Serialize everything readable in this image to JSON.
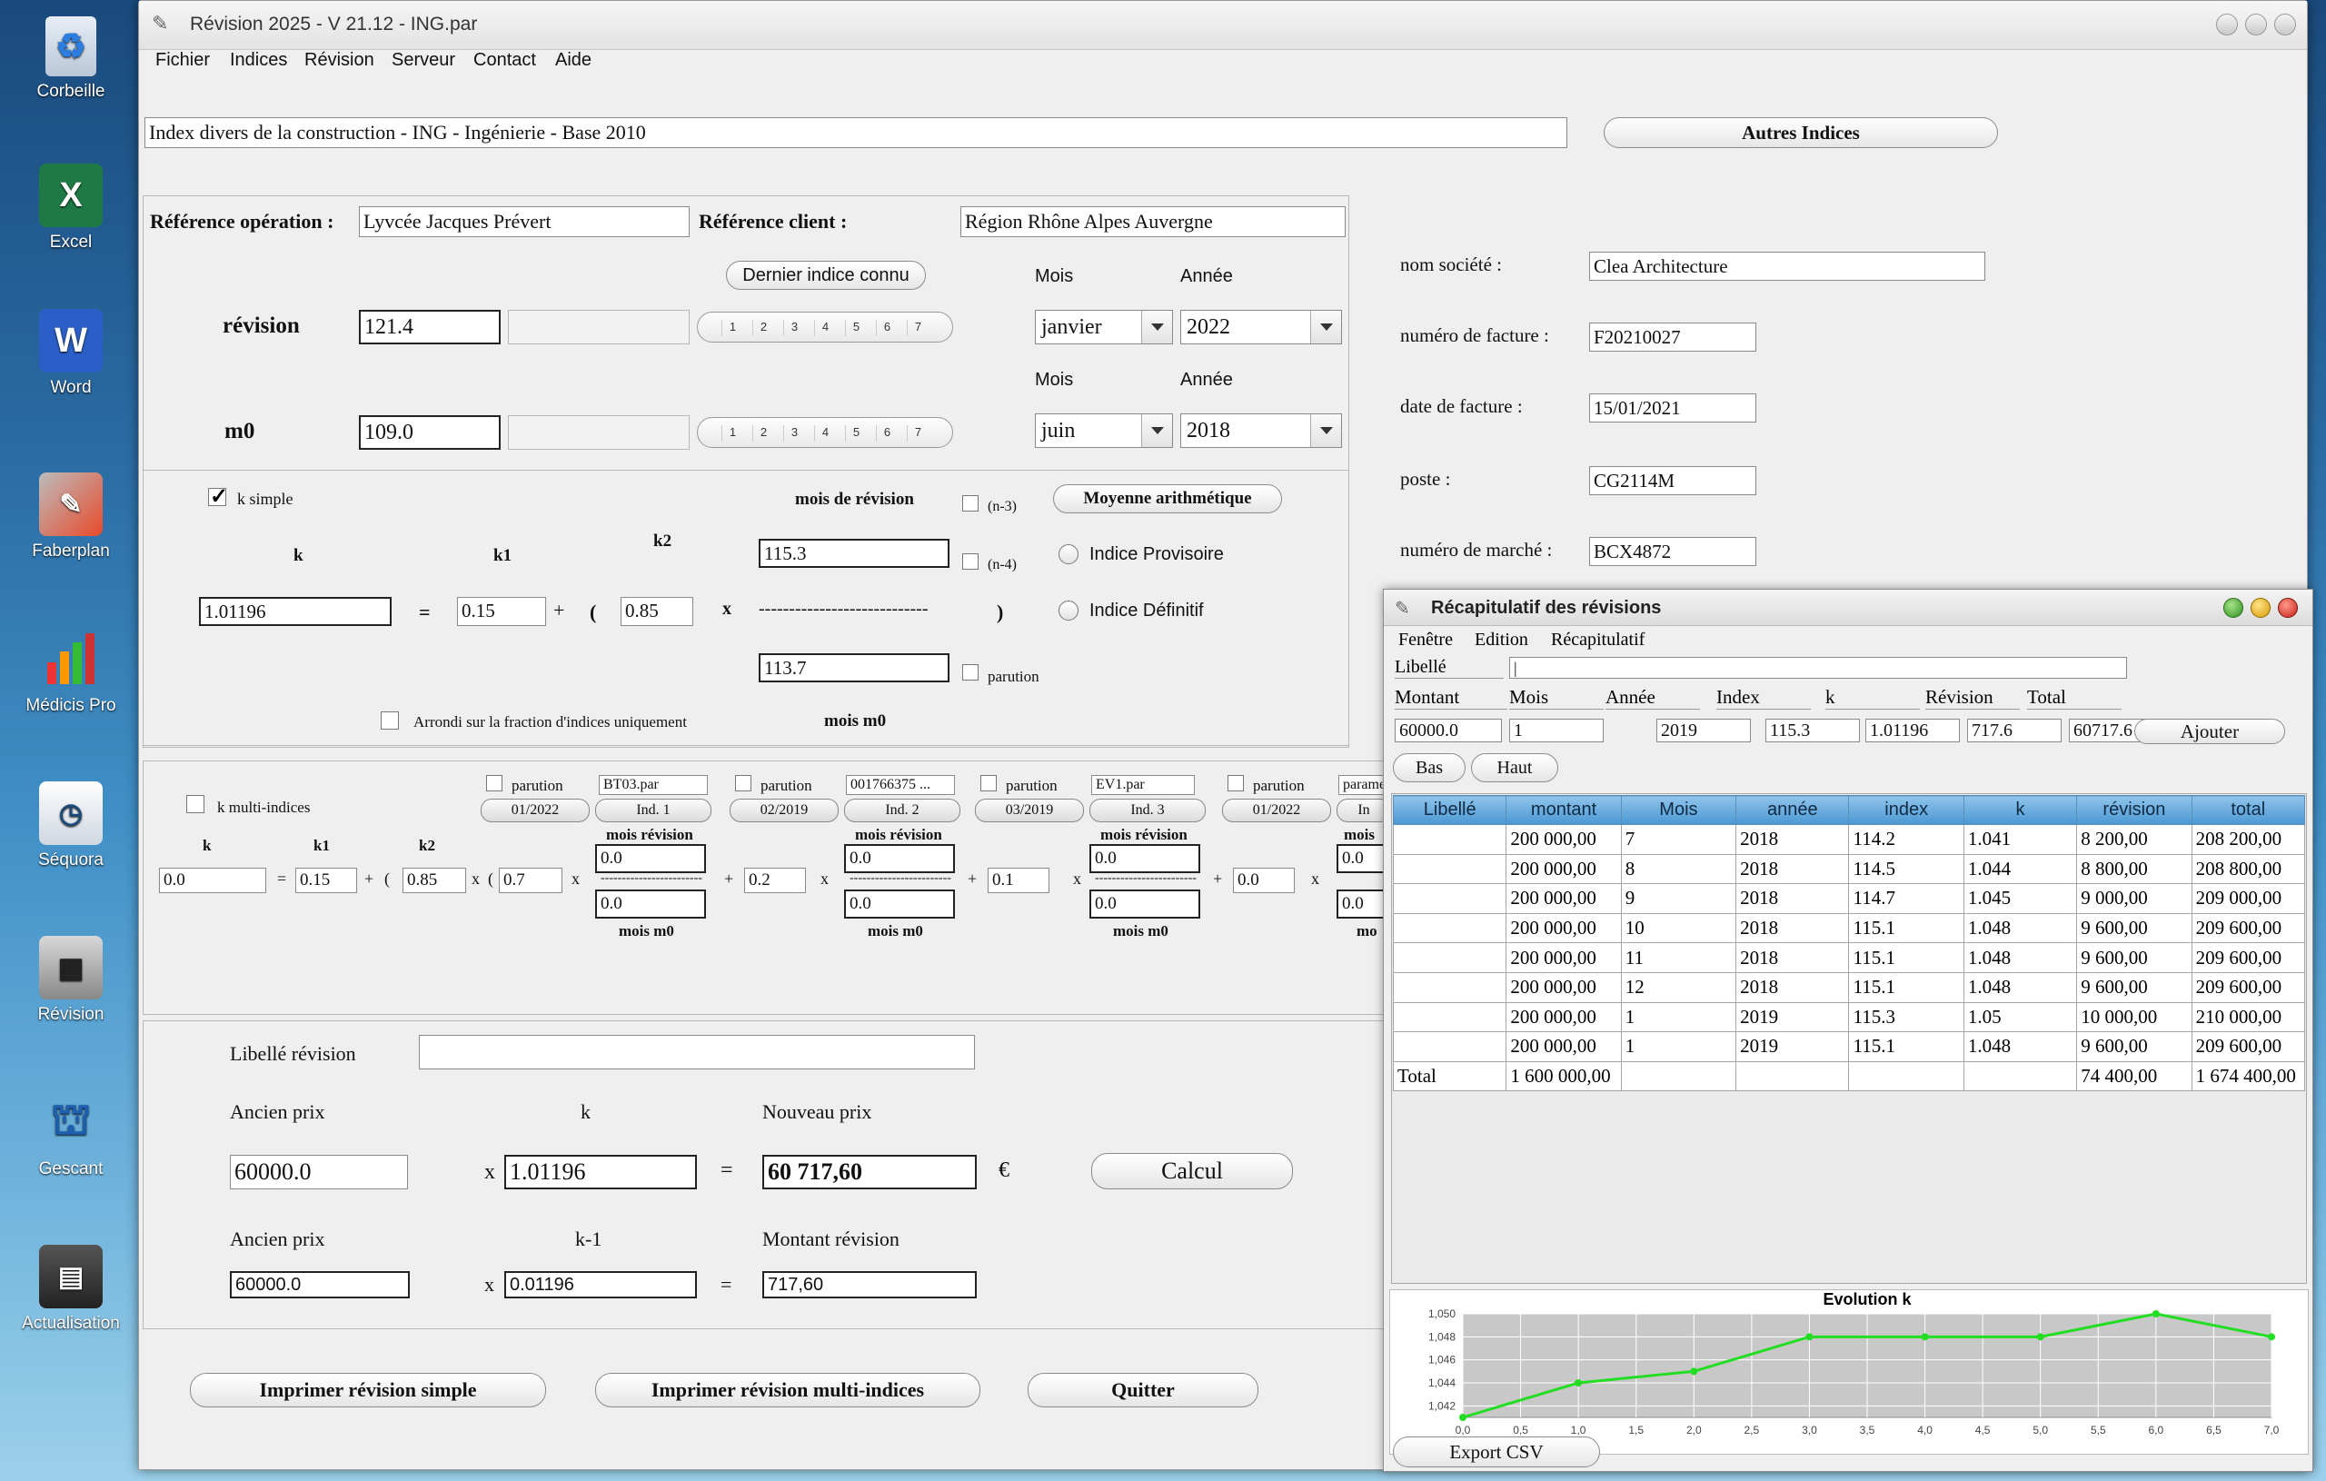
{
  "desktop": {
    "icons": [
      {
        "label": "Corbeille",
        "name": "recycle-bin-icon"
      },
      {
        "label": "Excel",
        "name": "excel-icon"
      },
      {
        "label": "Word",
        "name": "word-icon"
      },
      {
        "label": "Faberplan",
        "name": "faberplan-icon"
      },
      {
        "label": "Médicis Pro",
        "name": "medicis-pro-icon"
      },
      {
        "label": "Séquora",
        "name": "sequora-icon"
      },
      {
        "label": "Révision",
        "name": "revision-app-icon"
      },
      {
        "label": "Gescant",
        "name": "gescant-icon"
      },
      {
        "label": "Actualisation",
        "name": "actualisation-icon"
      }
    ]
  },
  "window": {
    "title": "Révision 2025 - V 21.12 - ING.par"
  },
  "menu": [
    "Fichier",
    "Indices",
    "Révision",
    "Serveur",
    "Contact",
    "Aide"
  ],
  "index_title": "Index divers de la construction - ING - Ingénierie - Base 2010",
  "autres_indices": "Autres Indices",
  "ref_op_label": "Référence opération :",
  "ref_op_value": "Lyvcée Jacques Prévert",
  "ref_client_label": "Référence client :",
  "ref_client_value": "Région Rhône Alpes Auvergne",
  "dernier_indice": "Dernier indice connu",
  "mois_label": "Mois",
  "annee_label": "Année",
  "revision_label": "révision",
  "revision_value": "121.4",
  "revision_mois": "janvier",
  "revision_annee": "2022",
  "m0_label": "m0",
  "m0_value": "109.0",
  "m0_mois": "juin",
  "m0_annee": "2018",
  "slider_ticks": [
    "1",
    "2",
    "3",
    "4",
    "5",
    "6",
    "7"
  ],
  "company": {
    "nom_label": "nom société :",
    "nom_value": "Clea Architecture",
    "facture_label": "numéro de facture :",
    "facture_value": "F20210027",
    "date_label": "date de facture :",
    "date_value": "15/01/2021",
    "poste_label": "poste :",
    "poste_value": "CG2114M",
    "marche_label": "numéro de marché :",
    "marche_value": "BCX4872"
  },
  "ksimple": {
    "label": "k simple",
    "mois_revision": "mois de révision",
    "n3": "(n-3)",
    "n4": "(n-4)",
    "moyenne": "Moyenne arithmétique",
    "provisoire": "Indice Provisoire",
    "definitif": "Indice Définitif",
    "k_label": "k",
    "k1_label": "k1",
    "k2_label": "k2",
    "k_value": "1.01196",
    "k1_value": "0.15",
    "k2_value": "0.85",
    "num_value": "115.3",
    "den_value": "113.7",
    "equals": "=",
    "plus": "+",
    "open": "(",
    "times": "x",
    "close": ")",
    "dashes": "----------------------------",
    "parution": "parution",
    "arrondi": "Arrondi sur la fraction d'indices uniquement",
    "mois_m0": "mois m0"
  },
  "kmulti": {
    "label": "k multi-indices",
    "k_label": "k",
    "k1_label": "k1",
    "k2_label": "k2",
    "k_value": "0.0",
    "k1_value": "0.15",
    "k2_value": "0.85",
    "first_coef": "0.7",
    "parution": "parution",
    "mois_revision": "mois révision",
    "mois_m0": "mois m0",
    "dashes": "------------------------",
    "groups": [
      {
        "file": "BT03.par",
        "date": "01/2022",
        "ind": "Ind. 1",
        "num": "0.0",
        "den": "0.0",
        "coef": "0.2"
      },
      {
        "file": "001766375  ...",
        "date": "02/2019",
        "ind": "Ind. 2",
        "num": "0.0",
        "den": "0.0",
        "coef": "0.1"
      },
      {
        "file": "EV1.par",
        "date": "03/2019",
        "ind": "Ind. 3",
        "num": "0.0",
        "den": "0.0",
        "coef": "0.0"
      },
      {
        "file": "parame",
        "date": "01/2022",
        "ind": "In",
        "num": "0.0",
        "den": "0.0",
        "coef": ""
      }
    ],
    "trunc_mois": "mois",
    "trunc_mo": "mo"
  },
  "calc": {
    "libelle_label": "Libellé révision",
    "libelle_value": "",
    "ancien_label": "Ancien prix",
    "k_label": "k",
    "nouveau_label": "Nouveau prix",
    "ancien_value": "60000.0",
    "k_value": "1.01196",
    "nouveau_value": "60 717,60",
    "euro": "€",
    "calcul": "Calcul",
    "ancien2_label": "Ancien prix",
    "km1_label": "k-1",
    "montant_label": "Montant révision",
    "ancien2_value": "60000.0",
    "km1_value": "0.01196",
    "montant_value": "717,60",
    "x": "x",
    "eq": "="
  },
  "buttons": {
    "print_simple": "Imprimer révision simple",
    "print_multi": "Imprimer révision multi-indices",
    "quit": "Quitter"
  },
  "recap": {
    "title": "Récapitulatif des révisions",
    "menu": [
      "Fenêtre",
      "Edition",
      "Récapitulatif"
    ],
    "libelle_label": "Libellé",
    "libelle_value": "|",
    "headers": [
      "Montant",
      "Mois",
      "Année",
      "Index",
      "k",
      "Révision",
      "Total"
    ],
    "values": [
      "60000.0",
      "1",
      "2019",
      "115.3",
      "1.01196",
      "717.6",
      "60717.6"
    ],
    "ajouter": "Ajouter",
    "bas": "Bas",
    "haut": "Haut",
    "table_headers": [
      "Libellé",
      "montant",
      "Mois",
      "année",
      "index",
      "k",
      "révision",
      "total"
    ],
    "rows": [
      [
        "",
        "200 000,00",
        "7",
        "2018",
        "114.2",
        "1.041",
        "8 200,00",
        "208 200,00"
      ],
      [
        "",
        "200 000,00",
        "8",
        "2018",
        "114.5",
        "1.044",
        "8 800,00",
        "208 800,00"
      ],
      [
        "",
        "200 000,00",
        "9",
        "2018",
        "114.7",
        "1.045",
        "9 000,00",
        "209 000,00"
      ],
      [
        "",
        "200 000,00",
        "10",
        "2018",
        "115.1",
        "1.048",
        "9 600,00",
        "209 600,00"
      ],
      [
        "",
        "200 000,00",
        "11",
        "2018",
        "115.1",
        "1.048",
        "9 600,00",
        "209 600,00"
      ],
      [
        "",
        "200 000,00",
        "12",
        "2018",
        "115.1",
        "1.048",
        "9 600,00",
        "209 600,00"
      ],
      [
        "",
        "200 000,00",
        "1",
        "2019",
        "115.3",
        "1.05",
        "10 000,00",
        "210 000,00"
      ],
      [
        "",
        "200 000,00",
        "1",
        "2019",
        "115.1",
        "1.048",
        "9 600,00",
        "209 600,00"
      ],
      [
        "Total",
        "1 600 000,00",
        "",
        "",
        "",
        "",
        "74 400,00",
        "1 674 400,00"
      ]
    ],
    "export": "Export CSV"
  },
  "chart_data": {
    "type": "line",
    "title": "Evolution k",
    "x": [
      0,
      1,
      2,
      3,
      4,
      5,
      6,
      7
    ],
    "series": [
      {
        "values": [
          1.041,
          1.044,
          1.045,
          1.048,
          1.048,
          1.048,
          1.05,
          1.048
        ]
      }
    ],
    "xlim": [
      0,
      7
    ],
    "ylim": [
      1.041,
      1.05
    ],
    "x_ticks": [
      "0,0",
      "0,5",
      "1,0",
      "1,5",
      "2,0",
      "2,5",
      "3,0",
      "3,5",
      "4,0",
      "4,5",
      "5,0",
      "5,5",
      "6,0",
      "6,5",
      "7,0"
    ],
    "y_ticks": [
      "1,042",
      "1,044",
      "1,046",
      "1,048",
      "1,050"
    ],
    "grid": true,
    "line_color": "#22dd22"
  }
}
